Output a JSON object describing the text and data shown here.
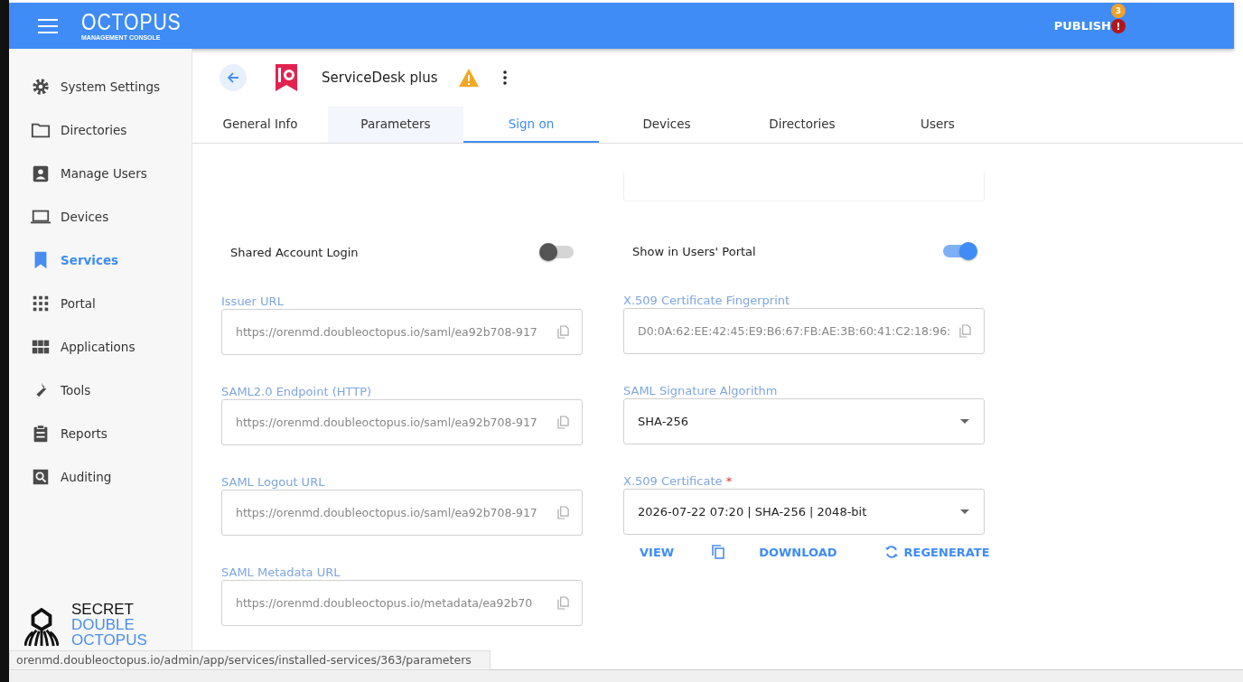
{
  "app_bar": {
    "title": "OCTOPUS",
    "subtitle": "MANAGEMENT CONSOLE",
    "publish": {
      "label": "PUBLISH",
      "count": "3",
      "alert": "!"
    }
  },
  "sidebar": {
    "items": [
      {
        "label": "System Settings",
        "selected": false
      },
      {
        "label": "Directories",
        "selected": false
      },
      {
        "label": "Manage Users",
        "selected": false
      },
      {
        "label": "Devices",
        "selected": false
      },
      {
        "label": "Services",
        "selected": true
      },
      {
        "label": "Portal",
        "selected": false
      },
      {
        "label": "Applications",
        "selected": false
      },
      {
        "label": "Tools",
        "selected": false
      },
      {
        "label": "Reports",
        "selected": false
      },
      {
        "label": "Auditing",
        "selected": false
      }
    ],
    "brand": [
      "SECRET",
      "DOUBLE",
      "OCTOPUS"
    ]
  },
  "header": {
    "title": "ServiceDesk plus",
    "warning": true
  },
  "tabs": [
    {
      "label": "General Info",
      "selected": false,
      "hovered": false
    },
    {
      "label": "Parameters",
      "selected": false,
      "hovered": true
    },
    {
      "label": "Sign on",
      "selected": true,
      "hovered": false
    },
    {
      "label": "Devices",
      "selected": false,
      "hovered": false
    },
    {
      "label": "Directories",
      "selected": false,
      "hovered": false
    },
    {
      "label": "Users",
      "selected": false,
      "hovered": false
    }
  ],
  "toggles": [
    {
      "label": "Shared Account Login",
      "on": false
    },
    {
      "label": "Show in Users' Portal",
      "on": true
    }
  ],
  "left_fields": [
    {
      "kind": "copy",
      "label": "Issuer URL",
      "value": "https://orenmd.doubleoctopus.io/saml/ea92b708-917"
    },
    {
      "kind": "copy",
      "label": "SAML2.0 Endpoint (HTTP)",
      "value": "https://orenmd.doubleoctopus.io/saml/ea92b708-917"
    },
    {
      "kind": "copy",
      "label": "SAML Logout URL",
      "value": "https://orenmd.doubleoctopus.io/saml/ea92b708-917"
    },
    {
      "kind": "copy",
      "label": "SAML Metadata URL",
      "value": "https://orenmd.doubleoctopus.io/metadata/ea92b70"
    }
  ],
  "right_fields": [
    {
      "kind": "copy",
      "label": "X.509 Certificate Fingerprint",
      "value": "D0:0A:62:EE:42:45:E9:B6:67:FB:AE:3B:60:41:C2:18:96:"
    },
    {
      "kind": "select",
      "label": "SAML Signature Algorithm",
      "value": "SHA-256"
    },
    {
      "kind": "select",
      "label": "X.509 Certificate",
      "value": "2026-07-22 07:20 | SHA-256 | 2048-bit",
      "required_mark": "*"
    }
  ],
  "cert_actions": [
    {
      "kind": "text",
      "label": "VIEW"
    },
    {
      "kind": "icon"
    },
    {
      "kind": "text",
      "label": "DOWNLOAD"
    },
    {
      "kind": "icon_text",
      "label": "REGENERATE"
    }
  ],
  "status_url": "orenmd.doubleoctopus.io/admin/app/services/installed-services/363/parameters"
}
